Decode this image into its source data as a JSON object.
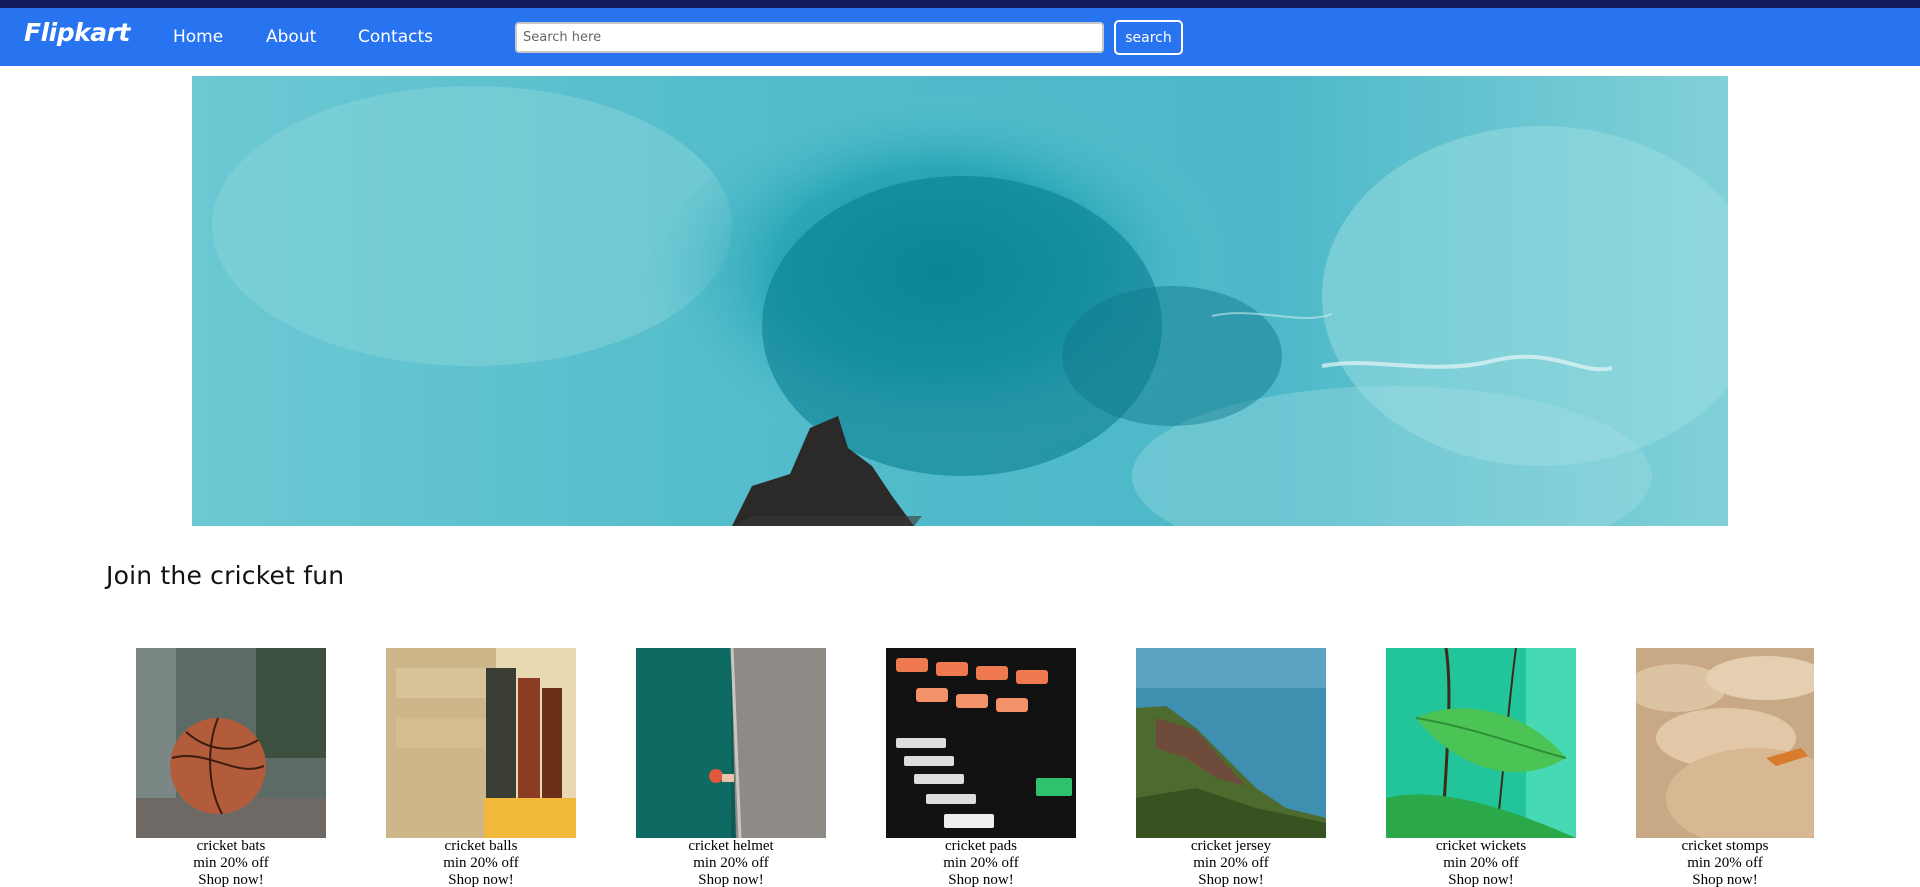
{
  "brand": {
    "name": "Flipkart"
  },
  "nav": {
    "links": [
      "Home",
      "About",
      "Contacts"
    ]
  },
  "search": {
    "placeholder": "Search here",
    "value": "",
    "button_label": "search"
  },
  "section": {
    "title": "Join the cricket fun"
  },
  "products": [
    {
      "name": "cricket bats",
      "discount": "min 20% off",
      "cta": "Shop now!"
    },
    {
      "name": "cricket balls",
      "discount": "min 20% off",
      "cta": "Shop now!"
    },
    {
      "name": "cricket helmet",
      "discount": "min 20% off",
      "cta": "Shop now!"
    },
    {
      "name": "cricket pads",
      "discount": "min 20% off",
      "cta": "Shop now!"
    },
    {
      "name": "cricket jersey",
      "discount": "min 20% off",
      "cta": "Shop now!"
    },
    {
      "name": "cricket wickets",
      "discount": "min 20% off",
      "cta": "Shop now!"
    },
    {
      "name": "cricket stomps",
      "discount": "min 20% off",
      "cta": "Shop now!"
    }
  ],
  "colors": {
    "navbar": "#2874f0",
    "topstrip": "#141a5c",
    "text": "#000000"
  }
}
